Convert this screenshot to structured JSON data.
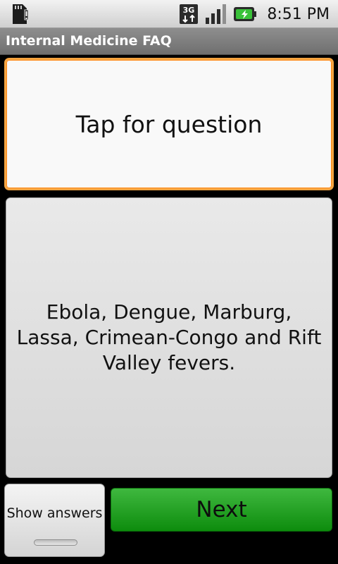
{
  "status_bar": {
    "network_badge": "3G",
    "time": "8:51 PM",
    "icons": [
      "sd-card-warning-icon",
      "3g-data-icon",
      "signal-strength-icon",
      "battery-charging-icon"
    ]
  },
  "title_bar": {
    "title": "Internal Medicine FAQ"
  },
  "question_card": {
    "text": "Tap for question"
  },
  "answer_card": {
    "text": "Ebola, Dengue, Marburg, Lassa, Crimean-Congo and Rift Valley fevers."
  },
  "controls": {
    "show_answers_label": "Show answers",
    "next_label": "Next"
  },
  "colors": {
    "focus_border": "#f5a542",
    "next_button": "#1fa21f",
    "title_bar": "#7a7a7a"
  }
}
